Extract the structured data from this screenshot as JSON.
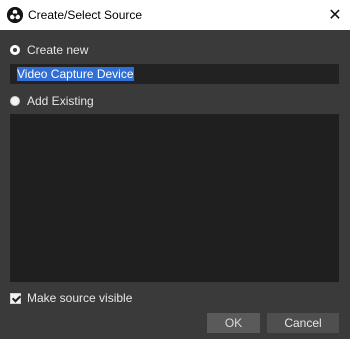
{
  "window": {
    "title": "Create/Select Source",
    "close_glyph": "✕"
  },
  "create_new": {
    "label": "Create new",
    "selected": true,
    "name_value": "Video Capture Device"
  },
  "add_existing": {
    "label": "Add Existing",
    "selected": false,
    "items": []
  },
  "make_visible": {
    "label": "Make source visible",
    "checked": true
  },
  "buttons": {
    "ok_label": "OK",
    "cancel_label": "Cancel"
  }
}
